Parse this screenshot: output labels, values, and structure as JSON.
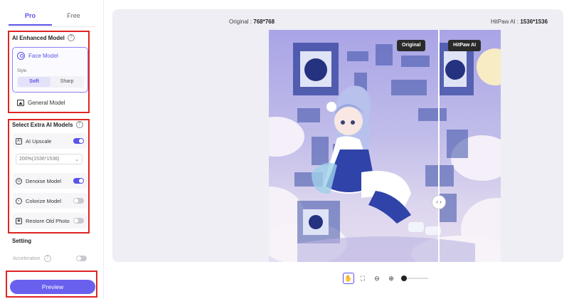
{
  "tabs": [
    {
      "label": "Pro",
      "active": true
    },
    {
      "label": "Free",
      "active": false
    }
  ],
  "ai_enhanced": {
    "title": "AI Enhanced Model",
    "face_model": "Face Model",
    "style_label": "Style",
    "style_options": [
      {
        "label": "Soft",
        "active": true
      },
      {
        "label": "Sharp",
        "active": false
      }
    ],
    "general_model": "General Model"
  },
  "extra_models": {
    "title": "Select Extra AI Models",
    "upscale": {
      "label": "AI Upscale",
      "enabled": true
    },
    "upscale_select": "200%(1536*1536)",
    "denoise": {
      "label": "Denoise Model",
      "enabled": true
    },
    "colorize": {
      "label": "Colorize Model",
      "enabled": false
    },
    "restore": {
      "label": "Restore Old Photo",
      "enabled": false
    }
  },
  "setting": {
    "title": "Setting",
    "acceleration": "Acceleration"
  },
  "preview_button": "Preview",
  "comparison": {
    "original_prefix": "Original :",
    "original_size": "768*768",
    "enhanced_prefix": "HitPaw AI :",
    "enhanced_size": "1536*1536",
    "badge_original": "Original",
    "badge_enhanced": "HitPaw AI"
  },
  "colors": {
    "accent": "#5b52e8",
    "highlight_box": "#e02424"
  },
  "icons": [
    "face-icon",
    "image-icon",
    "help-icon",
    "hand-icon",
    "fit-icon",
    "zoom-out-icon",
    "zoom-in-icon"
  ]
}
